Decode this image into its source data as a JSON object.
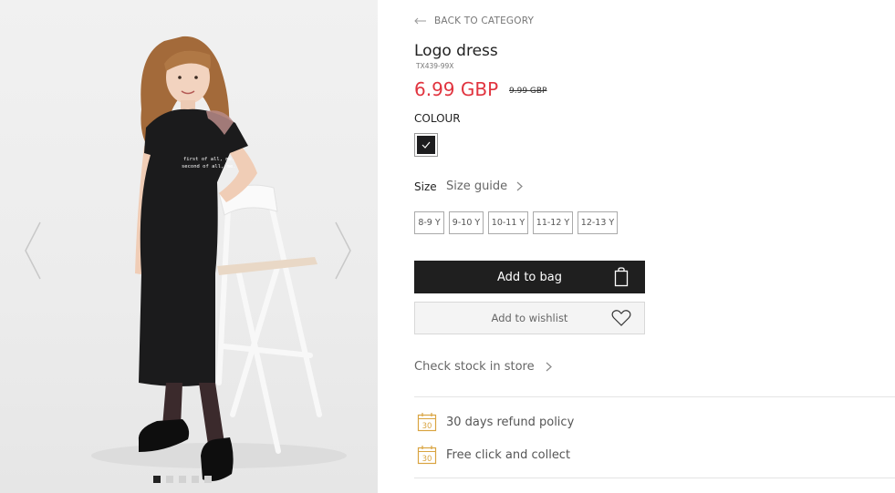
{
  "gallery": {
    "slide_count": 5,
    "active_slide": 1,
    "print_text": [
      "first of all, me.",
      "second of all, me."
    ],
    "prev_icon": "chevron-left-icon",
    "next_icon": "chevron-right-icon"
  },
  "product": {
    "back_label": "BACK TO CATEGORY",
    "name": "Logo dress",
    "sku": "TX439-99X",
    "price": "6.99 GBP",
    "old_price": "9.99 GBP",
    "colour_label": "COLOUR",
    "colour_swatch": "#1d1d1f",
    "size_label": "Size",
    "size_guide_label": "Size guide",
    "sizes": [
      "8-9 Y",
      "9-10 Y",
      "10-11 Y",
      "11-12 Y",
      "12-13 Y"
    ],
    "add_to_bag_label": "Add to bag",
    "add_to_wishlist_label": "Add to wishlist",
    "check_stock_label": "Check stock in store",
    "features": [
      {
        "icon": "calendar-30-icon",
        "icon_text": "30",
        "label": "30 days refund policy"
      },
      {
        "icon": "calendar-30-icon",
        "icon_text": "30",
        "label": "Free click and collect"
      }
    ]
  },
  "colors": {
    "price_red": "#e1343f",
    "button_dark": "#1f1f1f",
    "feature_icon_gold": "#d9a441"
  }
}
